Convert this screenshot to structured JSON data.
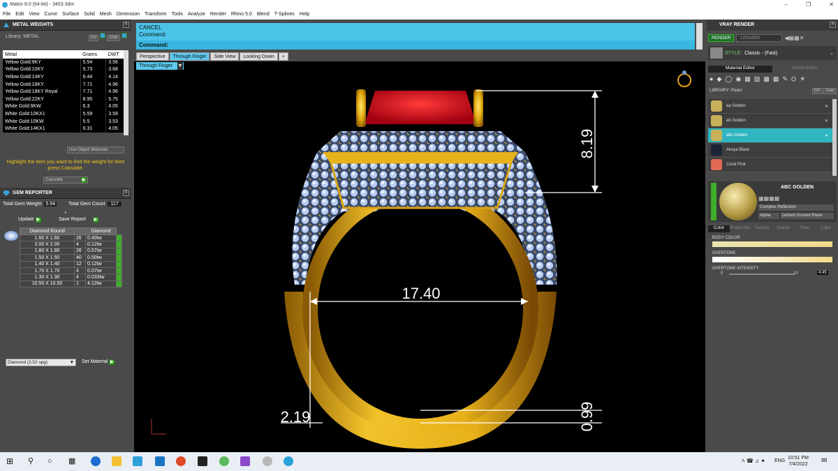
{
  "title": "Matrix 8.0 (64-bit) - 3453.3dm",
  "menu": [
    "File",
    "Edit",
    "View",
    "Curve",
    "Surface",
    "Solid",
    "Mesh",
    "Dimension",
    "Transform",
    "Tools",
    "Analyze",
    "Render",
    "Rhino 5.0",
    "Blend",
    "T-Splines",
    "Help"
  ],
  "metal": {
    "header": "METAL WEIGHTS",
    "library": "Library: METAL",
    "gv": "GV",
    "user": "User",
    "cols": [
      "Metal",
      "Grams",
      "DWT"
    ],
    "rows": [
      [
        "Yellow Gold:9KY",
        "5.54",
        "3.56"
      ],
      [
        "Yellow Gold:10KY",
        "5.73",
        "3.68"
      ],
      [
        "Yellow Gold:14KY",
        "6.44",
        "4.14"
      ],
      [
        "Yellow Gold:18KY",
        "7.71",
        "4.96"
      ],
      [
        "Yellow Gold:18KY Royal",
        "7.71",
        "4.96"
      ],
      [
        "Yellow Gold:22KY",
        "8.95",
        "5.75"
      ],
      [
        "White Gold:9KW",
        "6.3",
        "4.05"
      ],
      [
        "White Gold:10KX1",
        "5.59",
        "3.59"
      ],
      [
        "White Gold:10KW",
        "5.5",
        "3.53"
      ],
      [
        "White Gold:14KX1",
        "6.31",
        "4.05"
      ]
    ],
    "use_obj": "Use Object Materials",
    "hint": "Highlight the item you want to find the weight for then press Calculate.",
    "calc": "Calculate"
  },
  "gem": {
    "header": "GEM REPORTER",
    "total_w_label": "Total Gem Weight",
    "total_w": "5.94",
    "total_c_label": "Total Gem Count",
    "total_c": "117",
    "update": "Update",
    "save": "Save Report",
    "cols": [
      "Diamond Round",
      "",
      "Diamond"
    ],
    "rows": [
      [
        "1.60 X 1.60",
        "26",
        "0.40tw"
      ],
      [
        "2.00 X 2.00",
        "4",
        "0.12tw"
      ],
      [
        "1.80 X 1.80",
        "26",
        "0.57tw"
      ],
      [
        "1.50 X 1.50",
        "40",
        "0.50tw"
      ],
      [
        "1.40 X 1.40",
        "12",
        "0.12tw"
      ],
      [
        "1.70 X 1.70",
        "4",
        "0.07tw"
      ],
      [
        "1.30 X 1.30",
        "4",
        "0.033tw"
      ],
      [
        "10.50 X 10.50",
        "1",
        "4.12tw"
      ]
    ],
    "material_select": "Diamond    (3.52 spg)",
    "set_material": "Set Material"
  },
  "command": {
    "line1": "CANCEL",
    "line2": "Command:",
    "line3": "Command:"
  },
  "tabs": [
    "Perspective",
    "Through Finger",
    "Side View",
    "Looking Down",
    "+"
  ],
  "viewport_label": "Through Finger",
  "dims": {
    "top": "8.19",
    "inner": "17.40",
    "left": "2.19",
    "bottom": "0.99"
  },
  "vray": {
    "header": "VRAY RENDER",
    "render": "RENDER",
    "res": "1200x900",
    "style_label": "STYLE:",
    "style": "Classic - (Fast)",
    "tab_mat": "Material Editor",
    "tab_scene": "Scene Editor",
    "library": "LIBRARY: Pearl",
    "gv": "GV",
    "user": "User",
    "mats": [
      {
        "name": "aa Golden",
        "color": "#c9b15a"
      },
      {
        "name": "ab Golden",
        "color": "#c9b15a"
      },
      {
        "name": "abc Golden",
        "color": "#c9b15a"
      },
      {
        "name": "Akoya Black",
        "color": "#1a2436"
      },
      {
        "name": "Coral Pink",
        "color": "#e06a55"
      }
    ],
    "preview_title": "ABC GOLDEN",
    "type": "Complex Reflection",
    "alpha": "Alpha",
    "ground": "Default Ground Plane",
    "subtabs": [
      "Color",
      "Properties",
      "Texture",
      "Scene",
      "Toon",
      "Light"
    ],
    "body": "BODY COLOR",
    "overtone": "OVERTONE",
    "overtone_int": "OVERTONE INTENSITY",
    "min": "0",
    "max": "10",
    "val": "4.45"
  },
  "taskbar": {
    "time": "10:51 PM",
    "date": "7/4/2022",
    "lang": "ENG"
  }
}
